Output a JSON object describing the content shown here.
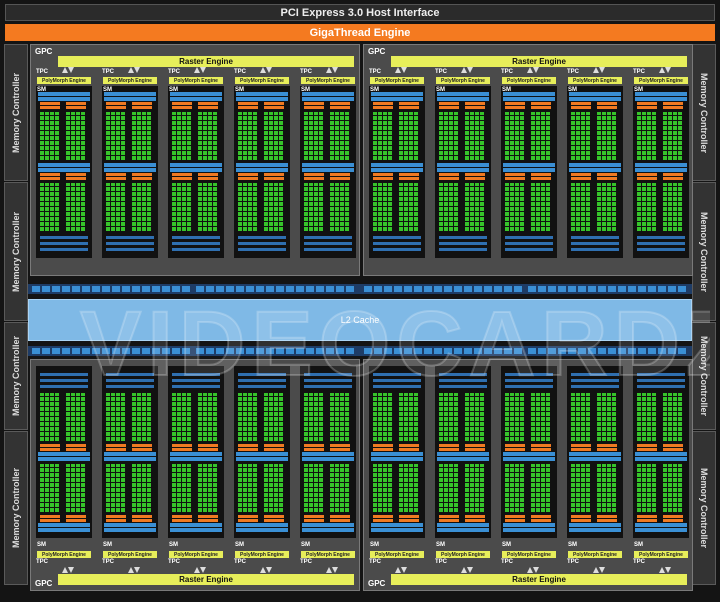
{
  "header": {
    "pcie_label": "PCI Express 3.0 Host Interface",
    "gigathread_label": "GigaThread Engine"
  },
  "memory_controller_label": "Memory Controller",
  "memory_controllers": [
    {
      "side": "left",
      "label": "Memory Controller"
    },
    {
      "side": "left",
      "label": "Memory Controller"
    },
    {
      "side": "left",
      "label": "Memory Controller"
    },
    {
      "side": "left",
      "label": "Memory Controller"
    },
    {
      "side": "right",
      "label": "Memory Controller"
    },
    {
      "side": "right",
      "label": "Memory Controller"
    },
    {
      "side": "right",
      "label": "Memory Controller"
    },
    {
      "side": "right",
      "label": "Memory Controller"
    }
  ],
  "gpc_label": "GPC",
  "raster_engine_label": "Raster Engine",
  "tpc_label": "TPC",
  "sm_label": "SM",
  "polymorph_label": "PolyMorph Engine",
  "l2_cache_label": "L2 Cache",
  "watermark_text": "VIDEOCARDZ.COM",
  "colors": {
    "gigathread": "#f47a20",
    "raster": "#e7ee5a",
    "cuda_core": "#36c42a",
    "cache": "#7fb9e6",
    "register": "#3a8fd4"
  }
}
